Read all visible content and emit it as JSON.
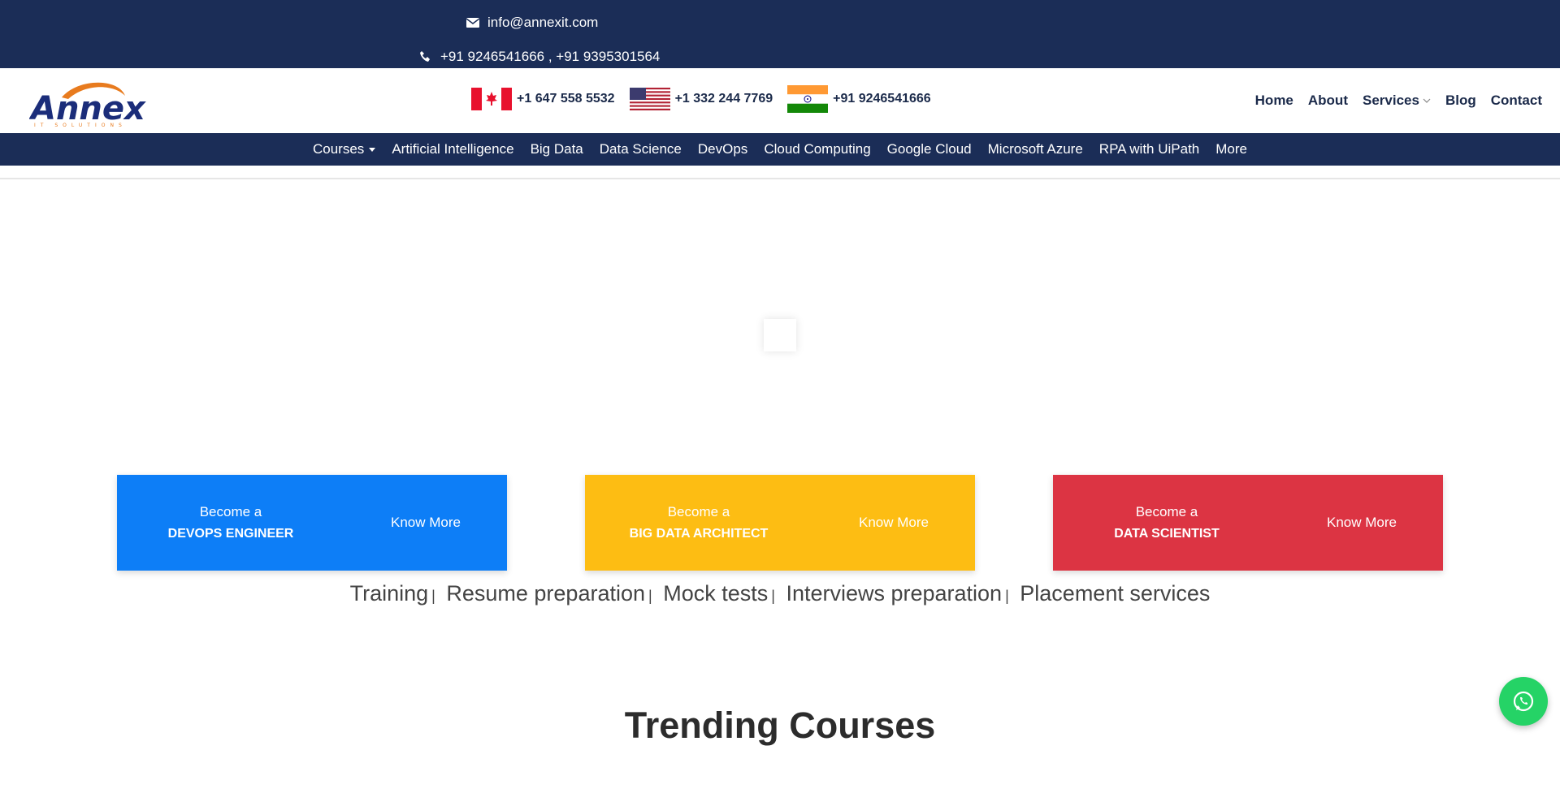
{
  "topbar": {
    "email": "info@annexit.com",
    "phone": "+91 9246541666 , +91 9395301564",
    "email_icon": "envelope-icon",
    "phone_icon": "phone-icon",
    "bg_color": "#1b2d57"
  },
  "header": {
    "logo_icon": "annex-logo",
    "contacts": [
      {
        "flag": "canada-flag-icon",
        "number": "+1 647 558 5532"
      },
      {
        "flag": "usa-flag-icon",
        "number": "+1 332 244 7769"
      },
      {
        "flag": "india-flag-icon",
        "number": "+91 9246541666"
      }
    ],
    "nav": [
      "Home",
      "About",
      "Services",
      "Blog",
      "Contact"
    ]
  },
  "course_nav": {
    "items": [
      "Courses",
      "Artificial Intelligence",
      "Big Data",
      "Data Science",
      "DevOps",
      "Cloud Computing",
      "Google Cloud",
      "Microsoft Azure",
      "RPA with UiPath",
      "More"
    ]
  },
  "cards": [
    {
      "pre": "Become a",
      "title": "DEVOPS ENGINEER",
      "cta": "Know More",
      "color": "#0d7ef7"
    },
    {
      "pre": "Become a",
      "title": "BIG DATA ARCHITECT",
      "cta": "Know More",
      "color": "#fdbd13"
    },
    {
      "pre": "Become a",
      "title": "DATA SCIENTIST",
      "cta": "Know More",
      "color": "#dc3443"
    }
  ],
  "services": [
    "Training",
    "Resume preparation",
    "Mock tests",
    "Interviews preparation",
    "Placement services"
  ],
  "services_separator": "|",
  "trending_title": "Trending Courses",
  "whatsapp_icon": "whatsapp-icon"
}
